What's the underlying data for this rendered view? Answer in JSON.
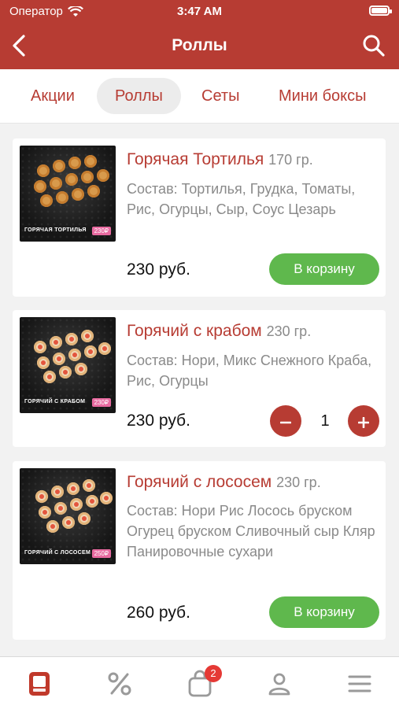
{
  "status": {
    "carrier": "Оператор",
    "time": "3:47 AM"
  },
  "nav": {
    "title": "Роллы"
  },
  "tabs": [
    {
      "label": "Акции"
    },
    {
      "label": "Роллы"
    },
    {
      "label": "Сеты"
    },
    {
      "label": "Мини боксы"
    }
  ],
  "products": [
    {
      "name": "Горячая Тортилья",
      "weight": "170 гр.",
      "desc": "Состав: Тортилья, Грудка, Томаты, Рис, Огурцы, Сыр, Соус Цезарь",
      "price": "230 руб.",
      "button": "В корзину",
      "image_caption": "ГОРЯЧАЯ ТОРТИЛЬЯ",
      "image_tag": "230₽"
    },
    {
      "name": "Горячий с крабом",
      "weight": "230 гр.",
      "desc": "Состав: Нори, Микс Снежного Краба, Рис, Огурцы",
      "price": "230 руб.",
      "quantity": "1",
      "image_caption": "ГОРЯЧИЙ С КРАБОМ",
      "image_tag": "230₽"
    },
    {
      "name": "Горячий с лососем",
      "weight": "230 гр.",
      "desc": "Состав: Нори Рис Лосось бруском Огурец бруском Сливочный сыр Кляр Панировочные сухари",
      "price": "260 руб.",
      "button": "В корзину",
      "image_caption": "ГОРЯЧИЙ С ЛОСОСЕМ",
      "image_tag": "250₽"
    }
  ],
  "tabbar": {
    "cart_badge": "2"
  },
  "colors": {
    "brand": "#b73c33",
    "green": "#5fb84d",
    "badge": "#e53935"
  },
  "icons": [
    "wifi-icon",
    "battery-icon",
    "back-icon",
    "search-icon",
    "menu-book-icon",
    "percent-icon",
    "cart-icon",
    "profile-icon",
    "hamburger-icon",
    "minus-icon",
    "plus-icon"
  ]
}
